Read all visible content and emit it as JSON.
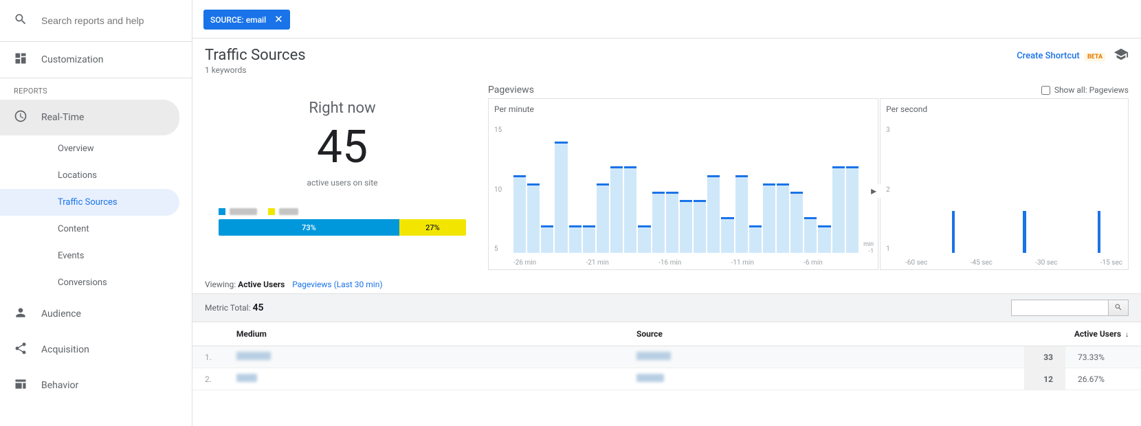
{
  "search_placeholder": "Search reports and help",
  "sidebar": {
    "customization": "Customization",
    "reports_label": "REPORTS",
    "realtime": "Real-Time",
    "sub": [
      "Overview",
      "Locations",
      "Traffic Sources",
      "Content",
      "Events",
      "Conversions"
    ],
    "audience": "Audience",
    "acquisition": "Acquisition",
    "behavior": "Behavior"
  },
  "filter_chip": {
    "key": "SOURCE:",
    "value": "email"
  },
  "header": {
    "title": "Traffic Sources",
    "subtitle": "1 keywords",
    "shortcut": "Create Shortcut",
    "beta": "BETA"
  },
  "realtime": {
    "right_now": "Right now",
    "count": "45",
    "label": "active users on site"
  },
  "breakdown": {
    "colors": [
      "#0098db",
      "#f2e600"
    ],
    "segments": [
      {
        "pct": 73,
        "label": "73%"
      },
      {
        "pct": 27,
        "label": "27%"
      }
    ]
  },
  "pageviews": {
    "title": "Pageviews",
    "showall": "Show all: Pageviews",
    "per_minute_label": "Per minute",
    "per_second_label": "Per second"
  },
  "chart_data": [
    {
      "type": "bar",
      "title": "Per minute",
      "ylim": [
        0,
        15
      ],
      "yticks": [
        15,
        10,
        5
      ],
      "x_ticks": [
        "-26 min",
        "-21 min",
        "-16 min",
        "-11 min",
        "-6 min",
        "-1 min"
      ],
      "values": [
        9,
        8,
        3,
        13,
        3,
        3,
        8,
        10,
        10,
        3,
        7,
        7,
        6,
        6,
        9,
        4,
        9,
        3,
        8,
        8,
        7,
        4,
        3,
        10,
        10,
        0
      ],
      "axis_min_label": "min\n-1"
    },
    {
      "type": "bar",
      "title": "Per second",
      "ylim": [
        0,
        3
      ],
      "yticks": [
        3,
        2,
        1
      ],
      "x_ticks": [
        "-60 sec",
        "-45 sec",
        "-30 sec",
        "-15 sec"
      ],
      "values": [
        0,
        0,
        0,
        0,
        0,
        0,
        0,
        0,
        0,
        0,
        0,
        0,
        0,
        0,
        1,
        0,
        0,
        0,
        0,
        0,
        0,
        0,
        0,
        0,
        0,
        0,
        0,
        0,
        0,
        0,
        0,
        0,
        0,
        1,
        0,
        0,
        0,
        0,
        0,
        0,
        0,
        0,
        0,
        0,
        0,
        0,
        0,
        0,
        0,
        0,
        0,
        0,
        0,
        1,
        0,
        0,
        0,
        0,
        0,
        0
      ]
    }
  ],
  "viewing": {
    "label": "Viewing:",
    "active": "Active Users",
    "pageviews": "Pageviews (Last 30 min)"
  },
  "metric_total": {
    "label": "Metric Total:",
    "value": "45"
  },
  "table": {
    "columns": [
      "Medium",
      "Source",
      "Active Users"
    ],
    "rows": [
      {
        "idx": "1.",
        "medium": "",
        "source": "",
        "active_users": "33",
        "pct": "73.33%"
      },
      {
        "idx": "2.",
        "medium": "",
        "source": "",
        "active_users": "12",
        "pct": "26.67%"
      }
    ]
  }
}
